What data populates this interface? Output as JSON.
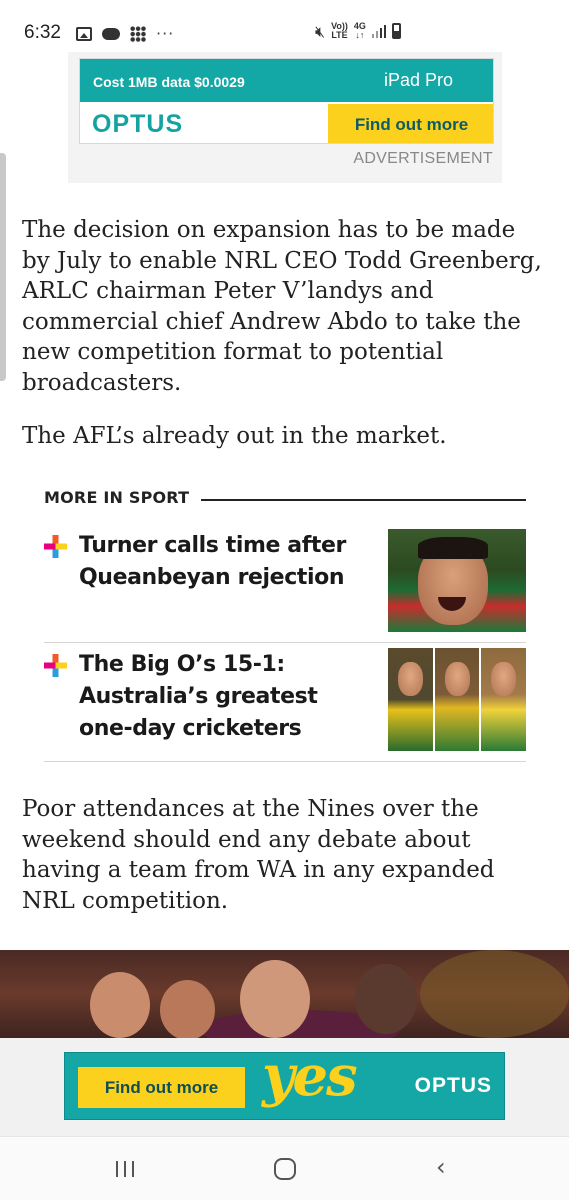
{
  "status_bar": {
    "time": "6:32",
    "left_icons": [
      "gallery-icon",
      "game-icon",
      "apps-grid-icon",
      "more-icon"
    ],
    "more_glyph": "···",
    "right_icons": [
      "mute-icon",
      "volte-icon",
      "4g-icon",
      "signal-icon",
      "battery-icon"
    ],
    "volte_label_top": "Vo))",
    "volte_label_bottom": "LTE",
    "network_top": "4G",
    "network_bottom": "↓↑"
  },
  "ad_top": {
    "cost_text": "Cost 1MB data $0.0029",
    "product": "iPad Pro",
    "apple_glyph": "",
    "brand": "OPTUS",
    "cta": "Find out more",
    "label": "ADVERTISEMENT",
    "colors": {
      "teal": "#13a8a6",
      "yellow": "#fbd11d"
    }
  },
  "article": {
    "paragraph_1": "The decision on expansion has to be made by July to enable NRL CEO Todd Greenberg, ARLC chairman Peter V’landys and commercial chief Andrew Abdo to take the new competition format to potential broadcasters.",
    "paragraph_2": "The AFL’s already out in the market.",
    "paragraph_3": "Poor attendances at the Nines over the weekend should end any debate about having a team from WA in any expanded NRL competition."
  },
  "more_in_sport": {
    "heading": "MORE IN SPORT",
    "stories": [
      {
        "title": "Turner calls time after Queanbeyan rejection",
        "image": "rugby-league-player-photo"
      },
      {
        "title": "The Big O’s 15-1: Australia’s greatest one-day cricketers",
        "image": "cricketers-collage-photo"
      }
    ]
  },
  "ad_bottom": {
    "cta": "Find out more",
    "yes_text": "yes",
    "brand": "OPTUS",
    "hero_image": "broncos-players-celebrating-photo"
  },
  "nav_bar": {
    "icons": [
      "recents-icon",
      "home-icon",
      "back-icon"
    ],
    "back_glyph": "‹"
  }
}
